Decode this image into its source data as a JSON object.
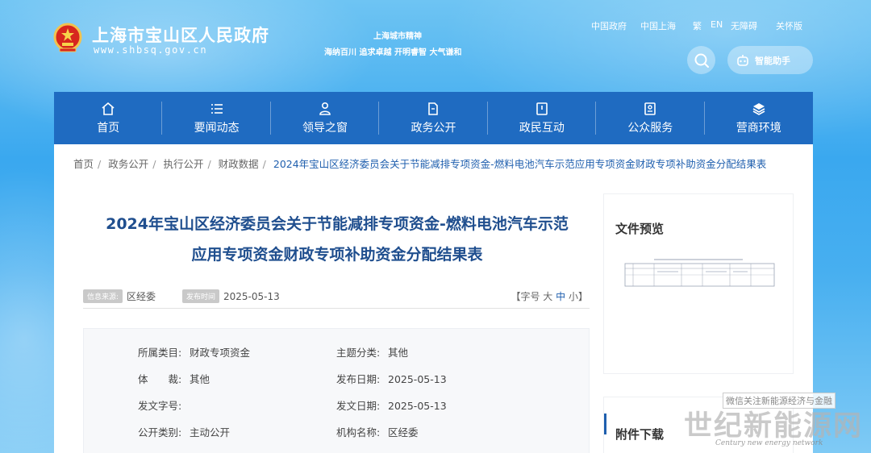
{
  "header": {
    "site_name": "上海市宝山区人民政府",
    "site_url": "www.shbsq.gov.cn",
    "spirit_title": "上海城市精神",
    "spirit_text": "海纳百川 追求卓越 开明睿智 大气谦和",
    "toplinks": [
      "中国政府",
      "中国上海",
      "繁",
      "EN",
      "无障碍",
      "关怀版"
    ],
    "assistant_label": "智能助手"
  },
  "nav": [
    {
      "label": "首页",
      "icon": "home-icon"
    },
    {
      "label": "要闻动态",
      "icon": "list-icon"
    },
    {
      "label": "领导之窗",
      "icon": "person-icon"
    },
    {
      "label": "政务公开",
      "icon": "document-icon"
    },
    {
      "label": "政民互动",
      "icon": "chat-icon"
    },
    {
      "label": "公众服务",
      "icon": "service-icon"
    },
    {
      "label": "营商环境",
      "icon": "layers-icon"
    }
  ],
  "breadcrumb": [
    "首页",
    "政务公开",
    "执行公开",
    "财政数据"
  ],
  "breadcrumb_current": "2024年宝山区经济委员会关于节能减排专项资金-燃料电池汽车示范应用专项资金财政专项补助资金分配结果表",
  "article": {
    "title_line1": "2024年宝山区经济委员会关于节能减排专项资金-燃料电池汽车示范",
    "title_line2": "应用专项资金财政专项补助资金分配结果表",
    "source_tag": "信息来源:",
    "source": "区经委",
    "date_tag": "发布时间",
    "date": "2025-05-13",
    "fontsize_prefix": "【字号",
    "fontsize_large": "大",
    "fontsize_mid": "中",
    "fontsize_small": "小】"
  },
  "info": {
    "category_label": "所属类目:",
    "category": "财政专项资金",
    "topic_label": "主题分类:",
    "topic": "其他",
    "style_label": "体　　裁:",
    "style": "其他",
    "pubdate_label": "发布日期:",
    "pubdate": "2025-05-13",
    "docno_label": "发文字号:",
    "docno": "",
    "docdate_label": "发文日期:",
    "docdate": "2025-05-13",
    "opentype_label": "公开类别:",
    "opentype": "主动公开",
    "org_label": "机构名称:",
    "org": "区经委"
  },
  "sidebar": {
    "preview_title": "文件预览",
    "attachment_title": "附件下载"
  },
  "watermark": {
    "sub": "微信关注新能源经济与金融",
    "main": "世纪新能源网",
    "en": "Century new energy network"
  },
  "colors": {
    "nav_bg": "#1f6bc1",
    "title": "#1f4e8e",
    "link": "#1f5fae"
  }
}
